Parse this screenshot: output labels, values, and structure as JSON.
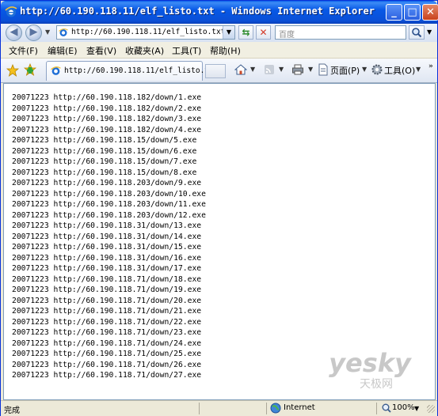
{
  "window": {
    "title": "http://60.190.118.11/elf_listo.txt - Windows Internet Explorer"
  },
  "address_bar": {
    "url": "http://60.190.118.11/elf_listo.txt"
  },
  "search": {
    "placeholder": "百度"
  },
  "menu": {
    "items": [
      "文件(F)",
      "编辑(E)",
      "查看(V)",
      "收藏夹(A)",
      "工具(T)",
      "帮助(H)"
    ]
  },
  "tab": {
    "label": "http://60.190.118.11/elf_listo.txt"
  },
  "commands": {
    "page_label": "页面(P)",
    "tools_label": "工具(O)"
  },
  "content": {
    "lines": [
      "20071223 http://60.190.118.182/down/1.exe",
      "20071223 http://60.190.118.182/down/2.exe",
      "20071223 http://60.190.118.182/down/3.exe",
      "20071223 http://60.190.118.182/down/4.exe",
      "20071223 http://60.190.118.15/down/5.exe",
      "20071223 http://60.190.118.15/down/6.exe",
      "20071223 http://60.190.118.15/down/7.exe",
      "20071223 http://60.190.118.15/down/8.exe",
      "20071223 http://60.190.118.203/down/9.exe",
      "20071223 http://60.190.118.203/down/10.exe",
      "20071223 http://60.190.118.203/down/11.exe",
      "20071223 http://60.190.118.203/down/12.exe",
      "20071223 http://60.190.118.31/down/13.exe",
      "20071223 http://60.190.118.31/down/14.exe",
      "20071223 http://60.190.118.31/down/15.exe",
      "20071223 http://60.190.118.31/down/16.exe",
      "20071223 http://60.190.118.31/down/17.exe",
      "20071223 http://60.190.118.71/down/18.exe",
      "20071223 http://60.190.118.71/down/19.exe",
      "20071223 http://60.190.118.71/down/20.exe",
      "20071223 http://60.190.118.71/down/21.exe",
      "20071223 http://60.190.118.71/down/22.exe",
      "20071223 http://60.190.118.71/down/23.exe",
      "20071223 http://60.190.118.71/down/24.exe",
      "20071223 http://60.190.118.71/down/25.exe",
      "20071223 http://60.190.118.71/down/26.exe",
      "20071223 http://60.190.118.71/down/27.exe"
    ]
  },
  "watermark": {
    "brand": "yesky",
    "sub": "天极网"
  },
  "status": {
    "text": "完成",
    "zone": "Internet",
    "zoom": "100%"
  },
  "colors": {
    "title_bar": "#0758e6",
    "close_button": "#c9411b",
    "watermark": "#c8c8c8"
  }
}
